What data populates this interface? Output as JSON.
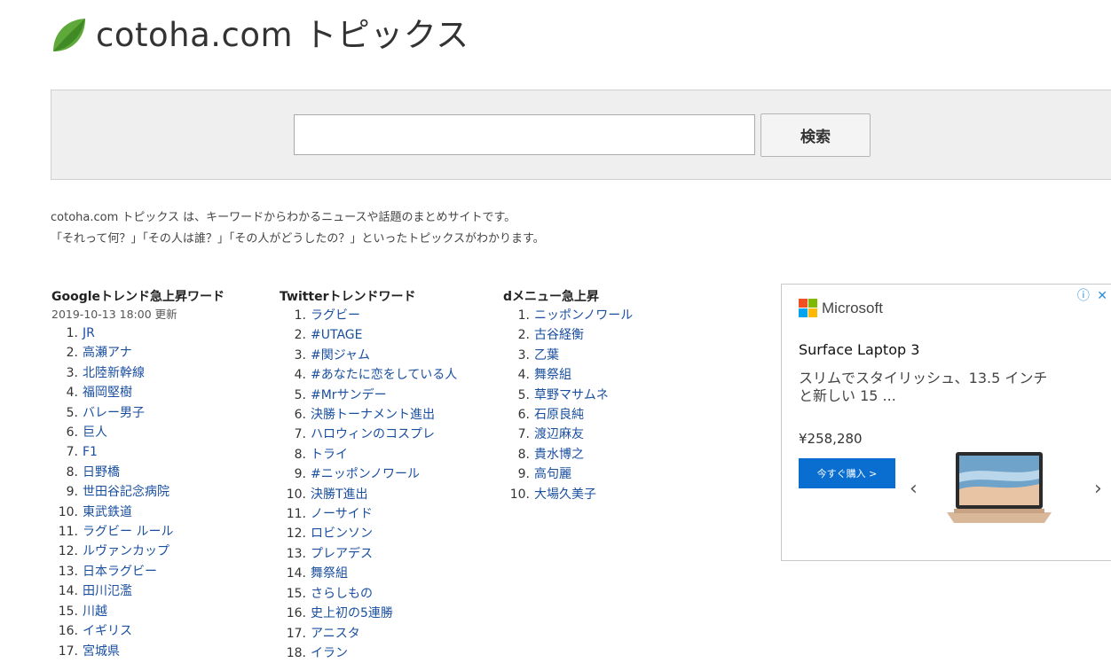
{
  "site": {
    "name": "cotoha.com トピックス"
  },
  "search": {
    "placeholder": "",
    "button_label": "検索"
  },
  "intro": {
    "line1": "cotoha.com トピックス は、キーワードからわかるニュースや話題のまとめサイトです。",
    "line2": "「それって何？」「その人は誰？」「その人がどうしたの？」といったトピックスがわかります。"
  },
  "google": {
    "title": "Googleトレンド急上昇ワード",
    "updated": "2019-10-13 18:00 更新",
    "items": [
      {
        "rank": "1.",
        "label": "JR"
      },
      {
        "rank": "2.",
        "label": "高瀬アナ"
      },
      {
        "rank": "3.",
        "label": "北陸新幹線"
      },
      {
        "rank": "4.",
        "label": "福岡堅樹"
      },
      {
        "rank": "5.",
        "label": "バレー男子"
      },
      {
        "rank": "6.",
        "label": "巨人"
      },
      {
        "rank": "7.",
        "label": "F1"
      },
      {
        "rank": "8.",
        "label": "日野橋"
      },
      {
        "rank": "9.",
        "label": "世田谷記念病院"
      },
      {
        "rank": "10.",
        "label": "東武鉄道"
      },
      {
        "rank": "11.",
        "label": "ラグビー ルール"
      },
      {
        "rank": "12.",
        "label": "ルヴァンカップ"
      },
      {
        "rank": "13.",
        "label": "日本ラグビー"
      },
      {
        "rank": "14.",
        "label": "田川氾濫"
      },
      {
        "rank": "15.",
        "label": "川越"
      },
      {
        "rank": "16.",
        "label": "イギリス"
      },
      {
        "rank": "17.",
        "label": "宮城県"
      }
    ]
  },
  "twitter": {
    "title": "Twitterトレンドワード",
    "items": [
      {
        "rank": "1.",
        "label": "ラグビー"
      },
      {
        "rank": "2.",
        "label": "#UTAGE"
      },
      {
        "rank": "3.",
        "label": "#関ジャム"
      },
      {
        "rank": "4.",
        "label": "#あなたに恋をしている人"
      },
      {
        "rank": "5.",
        "label": "#Mrサンデー"
      },
      {
        "rank": "6.",
        "label": "決勝トーナメント進出"
      },
      {
        "rank": "7.",
        "label": "ハロウィンのコスプレ"
      },
      {
        "rank": "8.",
        "label": "トライ"
      },
      {
        "rank": "9.",
        "label": "#ニッポンノワール"
      },
      {
        "rank": "10.",
        "label": "決勝T進出"
      },
      {
        "rank": "11.",
        "label": "ノーサイド"
      },
      {
        "rank": "12.",
        "label": "ロビンソン"
      },
      {
        "rank": "13.",
        "label": "プレアデス"
      },
      {
        "rank": "14.",
        "label": "舞祭組"
      },
      {
        "rank": "15.",
        "label": "さらしもの"
      },
      {
        "rank": "16.",
        "label": "史上初の5連勝"
      },
      {
        "rank": "17.",
        "label": "アニスタ"
      },
      {
        "rank": "18.",
        "label": "イラン"
      }
    ]
  },
  "dmenu": {
    "title": "dメニュー急上昇",
    "items": [
      {
        "rank": "1.",
        "label": "ニッポンノワール"
      },
      {
        "rank": "2.",
        "label": "古谷経衡"
      },
      {
        "rank": "3.",
        "label": "乙葉"
      },
      {
        "rank": "4.",
        "label": "舞祭組"
      },
      {
        "rank": "5.",
        "label": "草野マサムネ"
      },
      {
        "rank": "6.",
        "label": "石原良純"
      },
      {
        "rank": "7.",
        "label": "渡辺麻友"
      },
      {
        "rank": "8.",
        "label": "貴水博之"
      },
      {
        "rank": "9.",
        "label": "高句麗"
      },
      {
        "rank": "10.",
        "label": "大場久美子"
      }
    ]
  },
  "ad": {
    "brand": "Microsoft",
    "choices": "ⓘ ✕",
    "product": "Surface Laptop 3",
    "description": "スリムでスタイリッシュ、13.5 インチと新しい 15 ...",
    "price": "¥258,280",
    "cta": "今すぐ購入 >",
    "prev_icon": "chevron-left-icon",
    "next_icon": "chevron-right-icon",
    "ms_colors": [
      "#f25022",
      "#7fba00",
      "#00a4ef",
      "#ffb900"
    ]
  },
  "colors": {
    "link": "#1a4fa0",
    "leaf": "#5fa83a",
    "cta": "#0a6ed1"
  }
}
